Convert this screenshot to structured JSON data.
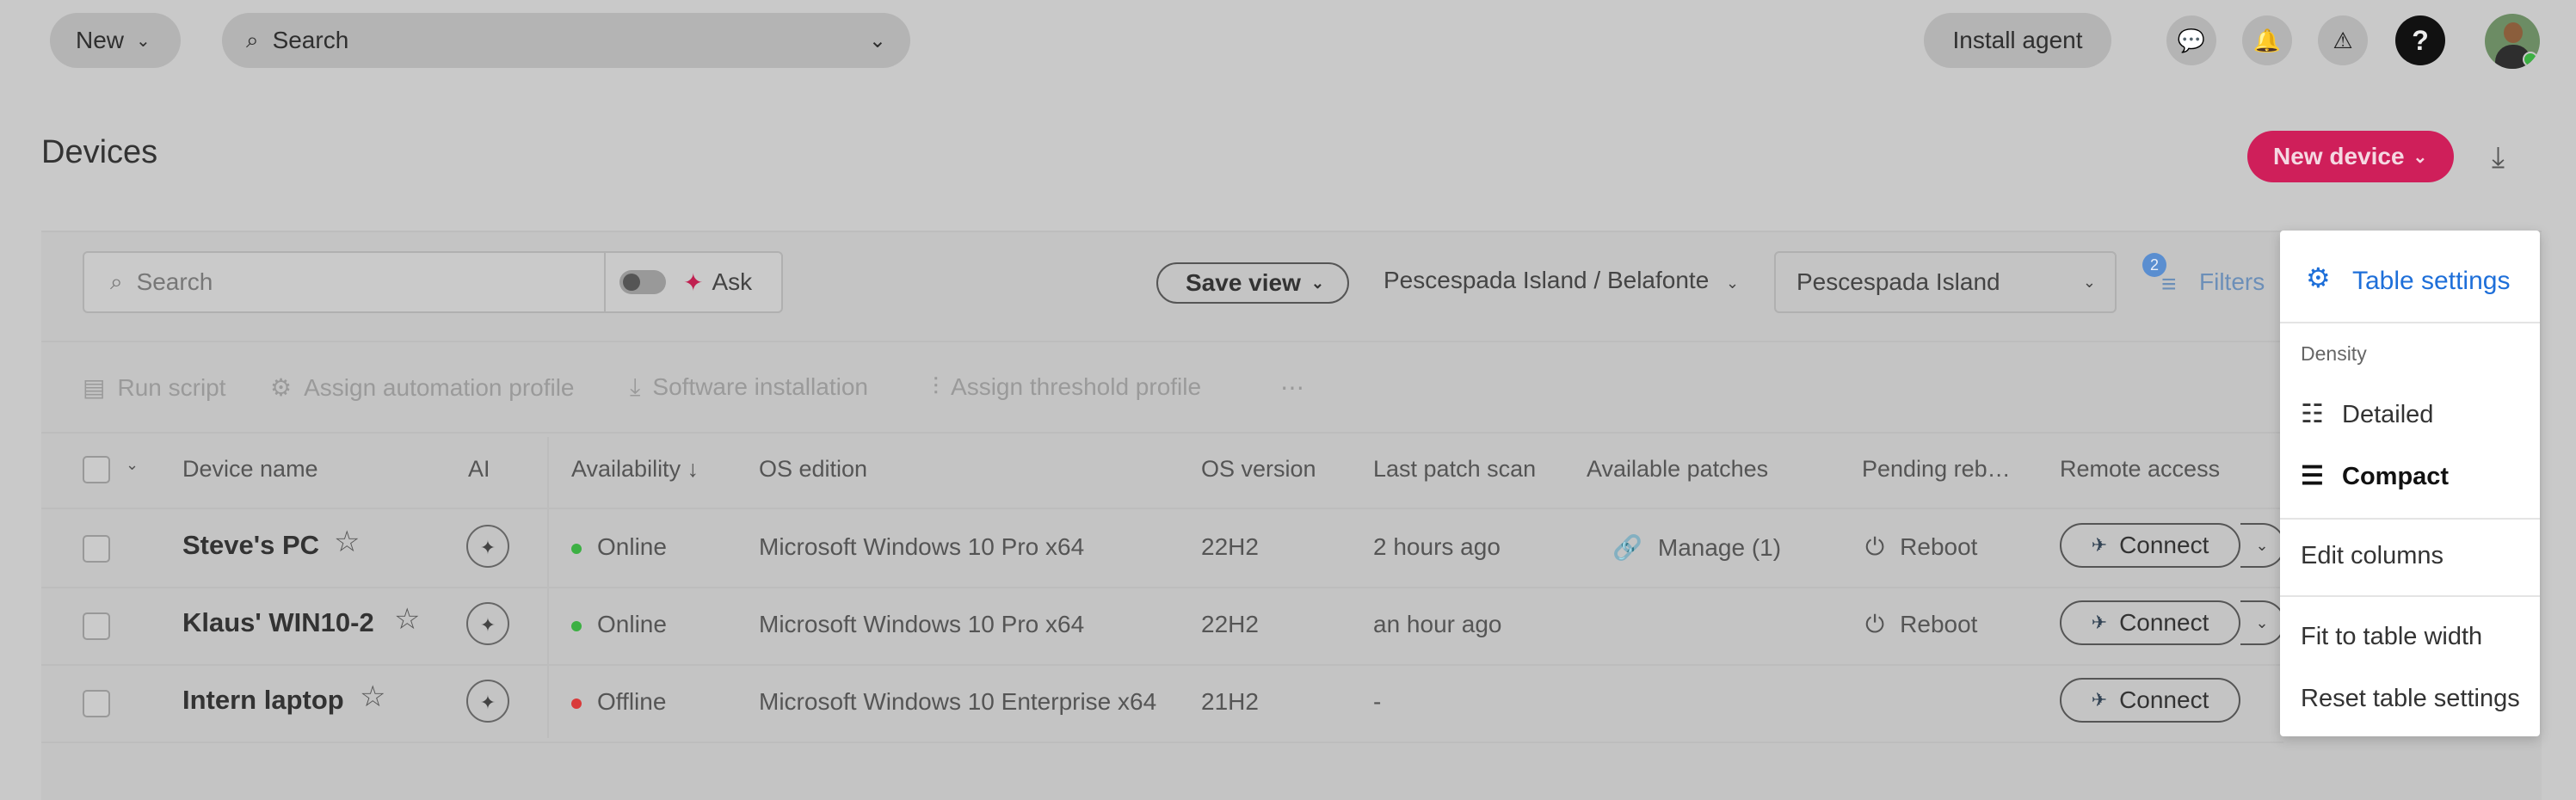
{
  "topbar": {
    "new_label": "New",
    "search_placeholder": "Search",
    "install_agent_label": "Install agent",
    "help_glyph": "?",
    "icons": [
      "chat-icon",
      "bell-icon",
      "alert-icon",
      "help-icon"
    ]
  },
  "page": {
    "title": "Devices",
    "new_device_label": "New device",
    "accent_color": "#cf1f5a"
  },
  "toolbar": {
    "search_placeholder": "Search",
    "ask_label": "Ask",
    "save_view_label": "Save view",
    "location_breadcrumb": "Pescespada Island / Belafonte",
    "location_select": "Pescespada Island",
    "filters_label": "Filters",
    "filters_count": "2"
  },
  "actions": {
    "run_script": "Run script",
    "assign_automation_profile": "Assign automation profile",
    "software_installation": "Software installation",
    "assign_threshold_profile": "Assign threshold profile",
    "more": "⋯"
  },
  "columns": {
    "device_name": "Device name",
    "ai": "AI",
    "availability": "Availability ↓",
    "os_edition": "OS edition",
    "os_version": "OS version",
    "last_patch_scan": "Last patch scan",
    "available_patches": "Available patches",
    "pending_reboot": "Pending reb…",
    "remote_access": "Remote access"
  },
  "rows": [
    {
      "name": "Steve's PC",
      "availability": "Online",
      "status_color": "#3cb043",
      "os_edition": "Microsoft Windows 10 Pro x64",
      "os_version": "22H2",
      "last_patch_scan": "2 hours ago",
      "patches": "Manage (1)",
      "reboot": "Reboot",
      "connect": "Connect"
    },
    {
      "name": "Klaus' WIN10-2",
      "availability": "Online",
      "status_color": "#3cb043",
      "os_edition": "Microsoft Windows 10 Pro x64",
      "os_version": "22H2",
      "last_patch_scan": "an hour ago",
      "patches": "",
      "reboot": "Reboot",
      "connect": "Connect"
    },
    {
      "name": "Intern laptop",
      "availability": "Offline",
      "status_color": "#d93a3a",
      "os_edition": "Microsoft Windows 10 Enterprise x64",
      "os_version": "21H2",
      "last_patch_scan": "-",
      "patches": "",
      "reboot": "",
      "connect": "Connect"
    }
  ],
  "table_settings": {
    "title": "Table settings",
    "density_label": "Density",
    "detailed": "Detailed",
    "compact": "Compact",
    "edit_columns": "Edit columns",
    "fit_to_width": "Fit to table width",
    "reset": "Reset table settings",
    "link_color": "#1e6fd9"
  }
}
